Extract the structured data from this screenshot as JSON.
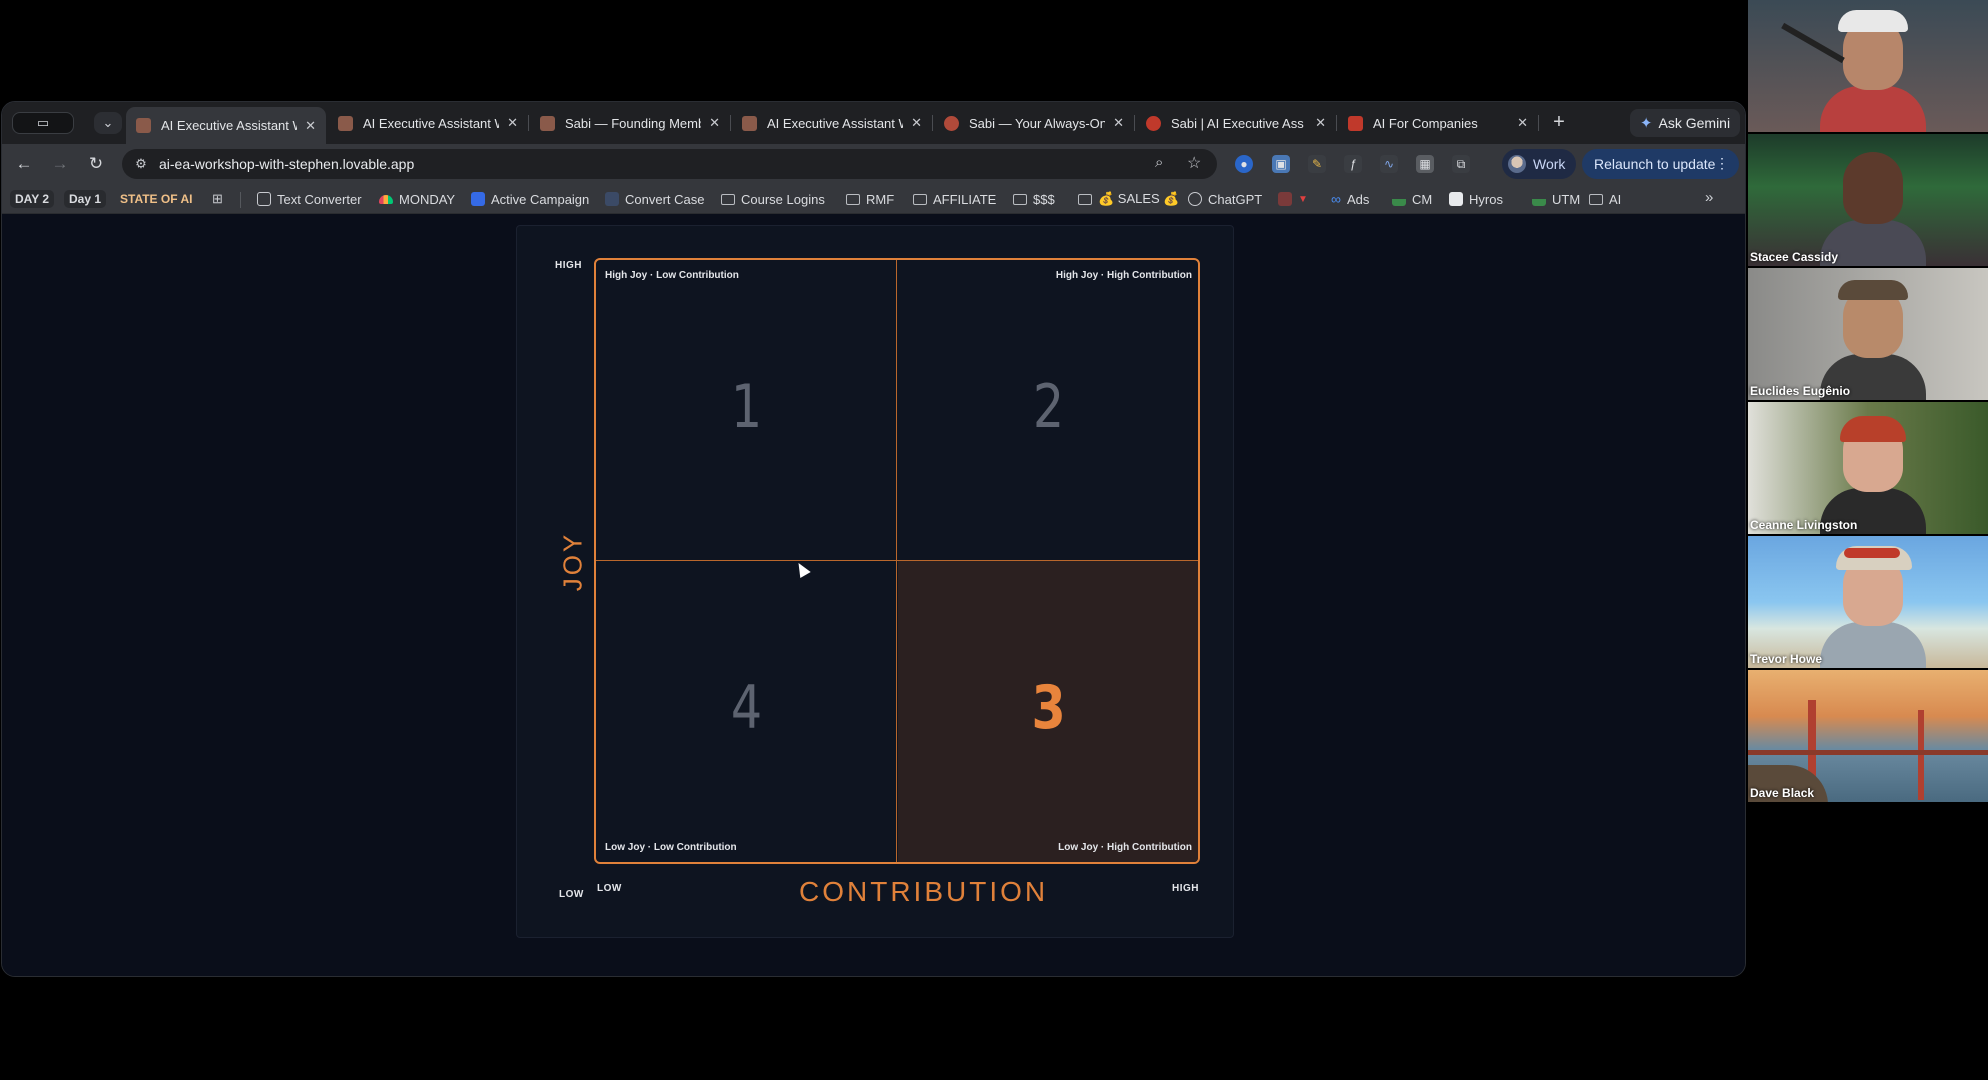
{
  "browser": {
    "tabs": [
      {
        "label": "AI Executive Assistant W",
        "active": true,
        "favicon_color": "#8a5a4a"
      },
      {
        "label": "AI Executive Assistant W",
        "active": false,
        "favicon_color": "#8a5a4a"
      },
      {
        "label": "Sabi — Founding Memb",
        "active": false,
        "favicon_color": "#8a5a4a"
      },
      {
        "label": "AI Executive Assistant W",
        "active": false,
        "favicon_color": "#8a5a4a"
      },
      {
        "label": "Sabi — Your Always-On",
        "active": false,
        "favicon_color": "#b04a3a"
      },
      {
        "label": "Sabi | AI Executive Ass",
        "active": false,
        "favicon_color": "#c0392b"
      },
      {
        "label": "AI For Companies",
        "active": false,
        "favicon_color": "#c0392b"
      }
    ],
    "tab_close_glyph": "✕",
    "new_tab_glyph": "+",
    "ask_gemini_label": "Ask Gemini",
    "url": "ai-ea-workshop-with-stephen.lovable.app",
    "profile_label": "Work",
    "relaunch_label": "Relaunch to update",
    "bookmarks": [
      {
        "label": "DAY 2",
        "type": "pill"
      },
      {
        "label": "Day 1",
        "type": "pill"
      },
      {
        "label": "STATE OF AI",
        "type": "text-orange"
      },
      {
        "label": "Text Converter",
        "type": "icon"
      },
      {
        "label": "MONDAY",
        "type": "icon"
      },
      {
        "label": "Active Campaign",
        "type": "icon"
      },
      {
        "label": "Convert Case",
        "type": "icon"
      },
      {
        "label": "Course Logins",
        "type": "folder"
      },
      {
        "label": "RMF",
        "type": "folder"
      },
      {
        "label": "AFFILIATE",
        "type": "folder"
      },
      {
        "label": "$$$",
        "type": "folder"
      },
      {
        "label": "💰 SALES 💰",
        "type": "folder"
      },
      {
        "label": "ChatGPT",
        "type": "icon"
      },
      {
        "label": "Ads",
        "type": "icon"
      },
      {
        "label": "CM",
        "type": "icon"
      },
      {
        "label": "Hyros",
        "type": "icon"
      },
      {
        "label": "UTM",
        "type": "icon"
      },
      {
        "label": "AI",
        "type": "folder"
      }
    ]
  },
  "matrix": {
    "y_axis_title": "JOY",
    "x_axis_title": "CONTRIBUTION",
    "y_high": "HIGH",
    "y_low": "LOW",
    "x_low": "LOW",
    "x_high": "HIGH",
    "q1": {
      "number": "1",
      "label": "High Joy · Low Contribution"
    },
    "q2": {
      "number": "2",
      "label": "High Joy · High Contribution"
    },
    "q3": {
      "number": "3",
      "label": "Low Joy · High Contribution",
      "highlighted": true
    },
    "q4": {
      "number": "4",
      "label": "Low Joy · Low Contribution"
    },
    "accent_color": "#e0813a"
  },
  "participants": [
    {
      "name": ""
    },
    {
      "name": "Stacee Cassidy"
    },
    {
      "name": "Euclides Eugênio"
    },
    {
      "name": "Ceanne Livingston"
    },
    {
      "name": "Trevor Howe"
    },
    {
      "name": "Dave Black"
    }
  ]
}
